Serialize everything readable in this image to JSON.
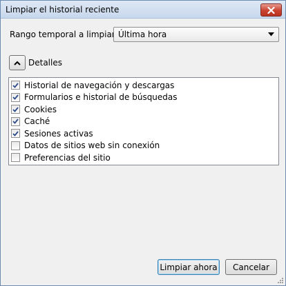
{
  "window": {
    "title": "Limpiar el historial reciente"
  },
  "time_range": {
    "label": "Rango temporal a limpiar:",
    "selected": "Última hora"
  },
  "details": {
    "label": "Detalles",
    "expanded": true
  },
  "items": [
    {
      "label": "Historial de navegación y descargas",
      "checked": true
    },
    {
      "label": "Formularios e historial de búsquedas",
      "checked": true
    },
    {
      "label": "Cookies",
      "checked": true
    },
    {
      "label": "Caché",
      "checked": true
    },
    {
      "label": "Sesiones activas",
      "checked": true
    },
    {
      "label": "Datos de sitios web sin conexión",
      "checked": false
    },
    {
      "label": "Preferencias del sitio",
      "checked": false
    }
  ],
  "buttons": {
    "clear_now": "Limpiar ahora",
    "cancel": "Cancelar"
  },
  "icons": {
    "close": "close-icon",
    "dropdown": "chevron-down-icon",
    "collapse": "chevron-up-icon",
    "check": "checkmark-icon"
  }
}
